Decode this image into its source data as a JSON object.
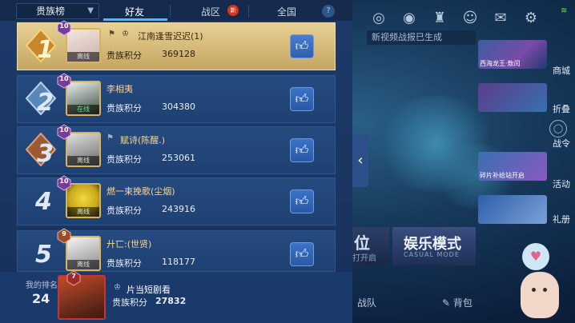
{
  "header": {
    "dropdown_label": "贵族榜",
    "tabs": [
      {
        "label": "好友",
        "active": true
      },
      {
        "label": "战区",
        "badge": "新"
      },
      {
        "label": "全国"
      }
    ],
    "help_glyph": "?"
  },
  "rows": [
    {
      "rank": "1",
      "level": "10",
      "name": "江南逢雪迟迟(1)",
      "status": "离线",
      "score_label": "贵族积分",
      "score": "369128",
      "is_me": true
    },
    {
      "rank": "2",
      "level": "10",
      "name": "李相夷",
      "status": "在线",
      "score_label": "贵族积分",
      "score": "304380"
    },
    {
      "rank": "3",
      "level": "10",
      "name": "赋诗(陈醒.)",
      "status": "离线",
      "score_label": "贵族积分",
      "score": "253061"
    },
    {
      "rank": "4",
      "level": "10",
      "name": "燃一束挽歌(尘烟)",
      "status": "离线",
      "score_label": "贵族积分",
      "score": "243916"
    },
    {
      "rank": "5",
      "level": "9",
      "name": "廾匸:(世贤)",
      "status": "离线",
      "score_label": "贵族积分",
      "score": "118177"
    }
  ],
  "my_rank": {
    "label": "我的排名",
    "rank": "24",
    "level": "7",
    "name": "片当短剧看",
    "score_label": "贵族积分",
    "score": "27832"
  },
  "right": {
    "banner": "新视频战报已生成",
    "side_cards": [
      {
        "caption": "西海龙王·敖闰",
        "label": "商城"
      },
      {
        "caption": "",
        "label": "折叠"
      },
      {
        "caption": "",
        "label": "战令"
      },
      {
        "caption": "碎片补给站开启",
        "label": "活动"
      },
      {
        "caption": "",
        "label": "礼册"
      }
    ],
    "mode_left_title": "位",
    "mode_left_sub": "打开启",
    "mode_title": "娱乐模式",
    "mode_sub": "CASUAL MODE",
    "team": "战队",
    "bag": "背包",
    "top_icons": [
      "target-icon",
      "eye-icon",
      "trophy-icon",
      "people-icon",
      "mail-icon",
      "settings-icon"
    ]
  },
  "colors": {
    "accent": "#4fb6ff",
    "gold_row": "#d9bd78",
    "like": "#3b73c8"
  }
}
